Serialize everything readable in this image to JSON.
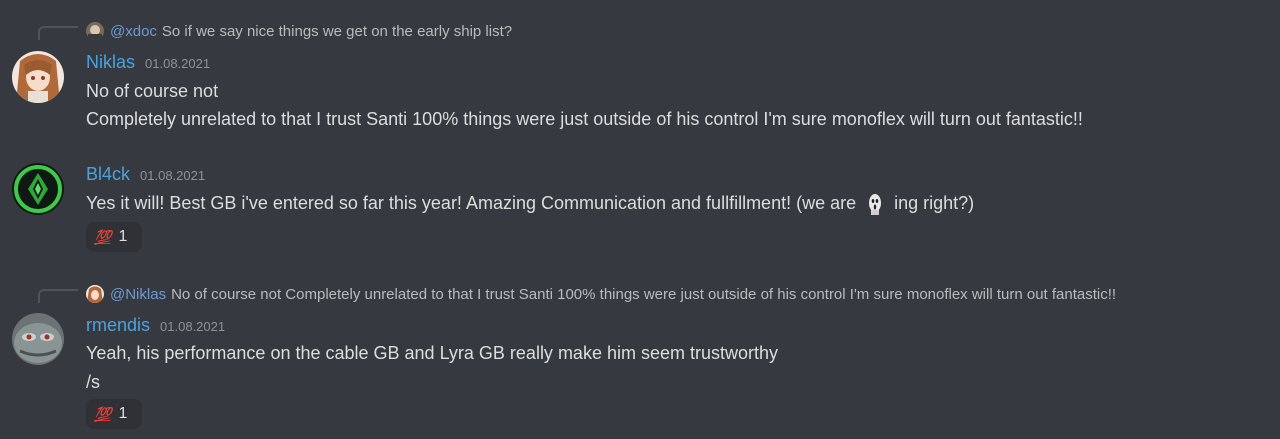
{
  "messages": [
    {
      "reply": {
        "mention": "@xdoc",
        "text": "So if we say nice things we get on the early ship list?"
      },
      "username": "Niklas",
      "timestamp": "01.08.2021",
      "lines": [
        "No of course not",
        "Completely unrelated to that I trust Santi 100% things were just outside of his control I'm sure monoflex will turn out fantastic!!"
      ]
    },
    {
      "username": "Bl4ck",
      "timestamp": "01.08.2021",
      "line_before_emoji": "Yes it will! Best GB i've entered so far this year! Amazing Communication and fullfillment! (we are",
      "line_after_emoji": "ing right?)",
      "reaction": {
        "emoji": "💯",
        "count": "1"
      }
    },
    {
      "reply": {
        "mention": "@Niklas",
        "text": "No of course not Completely unrelated to that I trust Santi 100% things were just outside of his control I'm sure monoflex will turn out fantastic!!"
      },
      "username": "rmendis",
      "timestamp": "01.08.2021",
      "lines": [
        "Yeah, his performance on the cable GB and Lyra GB really make him seem trustworthy",
        "/s"
      ],
      "reaction": {
        "emoji": "💯",
        "count": "1"
      }
    }
  ],
  "colors": {
    "background": "#36393f",
    "username": "#4aa3df",
    "mention": "#7289da",
    "text": "#dcddde",
    "timestamp": "#8e9297",
    "reaction_bg": "#2f3136"
  },
  "icons": {
    "hundred_emoji": "hundred-points-emoji",
    "inline_emoji": "ghost-face-emoji"
  }
}
